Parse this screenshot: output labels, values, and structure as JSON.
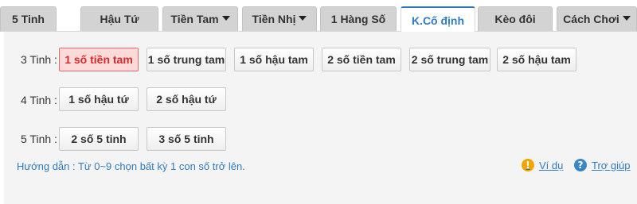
{
  "tabs": [
    {
      "label": "5 Tinh",
      "dropdown": false,
      "active": false
    },
    {
      "label": "Hậu Tứ",
      "dropdown": false,
      "active": false
    },
    {
      "label": "Tiền Tam",
      "dropdown": true,
      "active": false
    },
    {
      "label": "Tiền Nhị",
      "dropdown": true,
      "active": false
    },
    {
      "label": "1 Hàng Số",
      "dropdown": false,
      "active": false
    },
    {
      "label": "K.Cố định",
      "dropdown": false,
      "active": true
    },
    {
      "label": "Kèo đôi",
      "dropdown": false,
      "active": false
    },
    {
      "label": "Cách Chơi",
      "dropdown": true,
      "active": false
    }
  ],
  "rows": [
    {
      "label": "3 Tinh :",
      "buttons": [
        "1 số tiền tam",
        "1 số trung tam",
        "1 số hậu tam",
        "2 số tiền tam",
        "2 số trung tam",
        "2 số hậu tam"
      ],
      "selected": 0
    },
    {
      "label": "4 Tinh :",
      "buttons": [
        "1 số hậu tứ",
        "2 số hậu tứ"
      ]
    },
    {
      "label": "5 Tinh :",
      "buttons": [
        "2 số 5 tinh",
        "3 số 5 tinh"
      ]
    }
  ],
  "guide": "Hướng dẫn : Từ 0~9 chọn bất kỳ 1 con số trở lên.",
  "links": {
    "example": {
      "label": "Ví dụ",
      "icon": "warning-icon"
    },
    "help": {
      "label": "Trợ giúp",
      "icon": "help-icon"
    }
  },
  "colors": {
    "accent": "#2f7bc1",
    "selected_bg": "#fddada",
    "selected_border": "#e46b6b",
    "selected_text": "#d42a2a"
  }
}
